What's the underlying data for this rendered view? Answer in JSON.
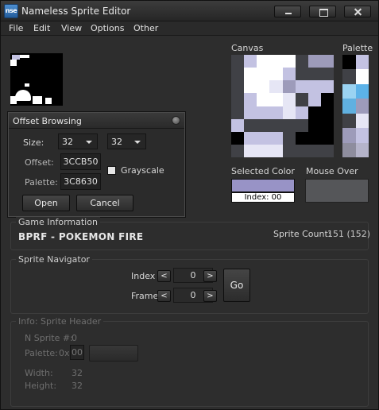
{
  "window": {
    "icon_text": "nse",
    "title": "Nameless Sprite Editor"
  },
  "menu": [
    "File",
    "Edit",
    "View",
    "Options",
    "Other"
  ],
  "canvas": {
    "label": "Canvas",
    "pixels": [
      [
        "#404146",
        "#c3c2e2",
        "#ffffff",
        "#ffffff",
        "#ffffff",
        "#404146",
        "#9d9bba",
        "#9d9bba"
      ],
      [
        "#404146",
        "#ffffff",
        "#ffffff",
        "#ffffff",
        "#c3c2e2",
        "#404146",
        "#404146",
        "#404146"
      ],
      [
        "#404146",
        "#ffffff",
        "#ffffff",
        "#e6e6f5",
        "#9d9bba",
        "#c3c2e2",
        "#c3c2e2",
        "#c3c2e2"
      ],
      [
        "#404146",
        "#c3c2e2",
        "#ffffff",
        "#ffffff",
        "#e6e6f5",
        "#404146",
        "#c3c2e2",
        "#000000"
      ],
      [
        "#404146",
        "#c3c2e2",
        "#c3c2e2",
        "#c3c2e2",
        "#e6e6f5",
        "#c3c2e2",
        "#000000",
        "#000000"
      ],
      [
        "#c3c2e2",
        "#404146",
        "#404146",
        "#404146",
        "#404146",
        "#404146",
        "#000000",
        "#000000"
      ],
      [
        "#000000",
        "#c3c2e2",
        "#c3c2e2",
        "#c3c2e2",
        "#404146",
        "#000000",
        "#000000",
        "#000000"
      ],
      [
        "#404146",
        "#e6e6f5",
        "#e6e6f5",
        "#e6e6f5",
        "#404146",
        "#404146",
        "#404146",
        "#404146"
      ]
    ]
  },
  "palette": {
    "label": "Palette",
    "colors": [
      [
        "#000000",
        "#c3c2e2"
      ],
      [
        "#404146",
        "#ffffff"
      ],
      [
        "#9ad3f2",
        "#5cb2e8"
      ],
      [
        "#60b0e0",
        "#9d9bba"
      ],
      [
        "#404146",
        "#e6e6f5"
      ],
      [
        "#9d9bba",
        "#c3c2e2"
      ],
      [
        "#8e8d9e",
        "#b5b4ca"
      ]
    ]
  },
  "selected_color": {
    "label": "Selected Color",
    "color": "#9893c6",
    "index_text": "Index: 00"
  },
  "mouse_over": {
    "label": "Mouse Over",
    "color": "#555659"
  },
  "offset_dialog": {
    "title": "Offset Browsing",
    "size_label": "Size:",
    "size_width": "32",
    "size_height": "32",
    "offset_label": "Offset:",
    "offset_value": "3CCB50",
    "palette_label": "Palette:",
    "palette_value": "3C8630",
    "grayscale_label": "Grayscale",
    "open_label": "Open",
    "cancel_label": "Cancel"
  },
  "game_info": {
    "group_title": "Game Information",
    "game_name": "BPRF  - POKEMON FIRE",
    "sprite_count_label": "Sprite Count:",
    "sprite_count_value": "151 (152)"
  },
  "navigator": {
    "group_title": "Sprite Navigator",
    "index_label": "Index",
    "index_value": "0",
    "frame_label": "Frame",
    "frame_value": "0",
    "prev_glyph": "<",
    "next_glyph": ">",
    "go_label": "Go"
  },
  "sprite_header": {
    "group_title": "Info: Sprite Header",
    "nsprite_label": "N Sprite #:",
    "nsprite_value": "0",
    "palette_label": "Palette:",
    "palette_prefix": "0x",
    "palette_value": "00",
    "width_label": "Width:",
    "width_value": "32",
    "height_label": "Height:",
    "height_value": "32"
  }
}
